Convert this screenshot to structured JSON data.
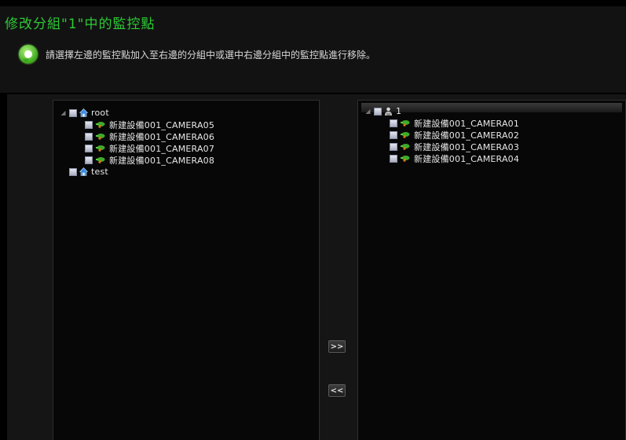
{
  "header": {
    "title": "修改分組\"1\"中的監控點",
    "info_text": "請選擇左邊的監控點加入至右邊的分組中或選中右邊分組中的監控點進行移除。"
  },
  "left_tree": {
    "root": {
      "label": "root",
      "icon": "home-icon",
      "expanded": true
    },
    "root_children": [
      {
        "label": "新建設備001_CAMERA05",
        "icon": "camera-icon"
      },
      {
        "label": "新建設備001_CAMERA06",
        "icon": "camera-icon"
      },
      {
        "label": "新建設備001_CAMERA07",
        "icon": "camera-icon"
      },
      {
        "label": "新建設備001_CAMERA08",
        "icon": "camera-icon"
      }
    ],
    "test": {
      "label": "test",
      "icon": "home-icon"
    }
  },
  "right_tree": {
    "group": {
      "label": "1",
      "icon": "group-icon",
      "expanded": true
    },
    "group_children": [
      {
        "label": "新建設備001_CAMERA01",
        "icon": "camera-icon"
      },
      {
        "label": "新建設備001_CAMERA02",
        "icon": "camera-icon"
      },
      {
        "label": "新建設備001_CAMERA03",
        "icon": "camera-icon"
      },
      {
        "label": "新建設備001_CAMERA04",
        "icon": "camera-icon"
      }
    ]
  },
  "buttons": {
    "add_label": ">>",
    "remove_label": "<<"
  },
  "colors": {
    "title_green": "#2ec936",
    "background": "#000000",
    "panel": "#070707"
  }
}
